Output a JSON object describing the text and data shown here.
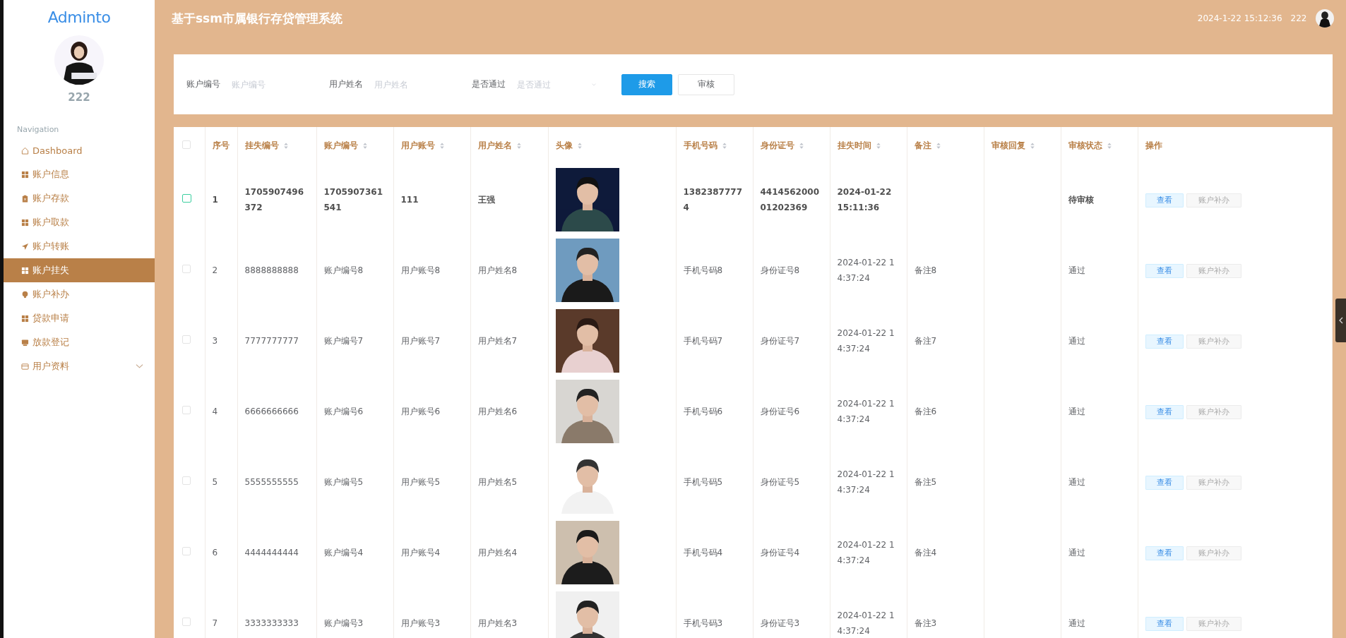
{
  "header": {
    "title": "基于ssm市属银行存贷管理系统",
    "datetime": "2024-1-22 15:12:36",
    "username": "222"
  },
  "sidebar": {
    "logo": "Adminto",
    "username": "222",
    "section": "Navigation",
    "items": [
      {
        "label": "Dashboard",
        "kind": "home",
        "selected": false
      },
      {
        "label": "账户信息",
        "kind": "grid",
        "selected": false
      },
      {
        "label": "账户存款",
        "kind": "clipboard",
        "selected": false
      },
      {
        "label": "账户取款",
        "kind": "grid",
        "selected": false
      },
      {
        "label": "账户转账",
        "kind": "plane",
        "selected": false
      },
      {
        "label": "账户挂失",
        "kind": "grid",
        "selected": true
      },
      {
        "label": "账户补办",
        "kind": "bulb",
        "selected": false
      },
      {
        "label": "贷款申请",
        "kind": "grid",
        "selected": false
      },
      {
        "label": "放款登记",
        "kind": "box",
        "selected": false
      },
      {
        "label": "用户资料",
        "kind": "card",
        "selected": false,
        "expanded": false
      }
    ]
  },
  "search": {
    "fields": [
      {
        "label": "账户编号",
        "placeholder": "账户编号",
        "kind": "input"
      },
      {
        "label": "用户姓名",
        "placeholder": "用户姓名",
        "kind": "input"
      },
      {
        "label": "是否通过",
        "placeholder": "是否通过",
        "kind": "select"
      }
    ],
    "buttons": [
      {
        "label": "搜索",
        "kind": "primary"
      },
      {
        "label": "审核",
        "kind": "plain"
      }
    ]
  },
  "table": {
    "all_checked": false,
    "columns": [
      {
        "label": "序号",
        "sortable": false
      },
      {
        "label": "挂失编号",
        "sortable": true
      },
      {
        "label": "账户编号",
        "sortable": true
      },
      {
        "label": "用户账号",
        "sortable": true
      },
      {
        "label": "用户姓名",
        "sortable": true
      },
      {
        "label": "头像",
        "sortable": true
      },
      {
        "label": "手机号码",
        "sortable": true
      },
      {
        "label": "身份证号",
        "sortable": true
      },
      {
        "label": "挂失时间",
        "sortable": true
      },
      {
        "label": "备注",
        "sortable": true
      },
      {
        "label": "审核回复",
        "sortable": true
      },
      {
        "label": "审核状态",
        "sortable": true
      },
      {
        "label": "操作",
        "sortable": false
      }
    ],
    "rows": [
      {
        "hovered": true,
        "index": "1",
        "loss_no": "1705907496372",
        "account_no": "1705907361541",
        "user_account": "111",
        "user_name": "王强",
        "phone": "13823877774",
        "id_no": "441456200001202369",
        "time": "2024-01-22 15:11:36",
        "status": "待审核",
        "actions": [
          "查看",
          "账户补办"
        ]
      },
      {
        "hovered": false,
        "index": "2",
        "loss_no": "8888888888",
        "account_no": "账户编号8",
        "user_account": "用户账号8",
        "user_name": "用户姓名8",
        "phone": "手机号码8",
        "id_no": "身份证号8",
        "time": "2024-01-22 14:37:24",
        "note": "备注8",
        "status": "通过",
        "actions": [
          "查看",
          "账户补办"
        ]
      },
      {
        "hovered": false,
        "index": "3",
        "loss_no": "7777777777",
        "account_no": "账户编号7",
        "user_account": "用户账号7",
        "user_name": "用户姓名7",
        "phone": "手机号码7",
        "id_no": "身份证号7",
        "time": "2024-01-22 14:37:24",
        "note": "备注7",
        "status": "通过",
        "actions": [
          "查看",
          "账户补办"
        ]
      },
      {
        "hovered": false,
        "index": "4",
        "loss_no": "6666666666",
        "account_no": "账户编号6",
        "user_account": "用户账号6",
        "user_name": "用户姓名6",
        "phone": "手机号码6",
        "id_no": "身份证号6",
        "time": "2024-01-22 14:37:24",
        "note": "备注6",
        "status": "通过",
        "actions": [
          "查看",
          "账户补办"
        ]
      },
      {
        "hovered": false,
        "index": "5",
        "loss_no": "5555555555",
        "account_no": "账户编号5",
        "user_account": "用户账号5",
        "user_name": "用户姓名5",
        "phone": "手机号码5",
        "id_no": "身份证号5",
        "time": "2024-01-22 14:37:24",
        "note": "备注5",
        "status": "通过",
        "actions": [
          "查看",
          "账户补办"
        ]
      },
      {
        "hovered": false,
        "index": "6",
        "loss_no": "4444444444",
        "account_no": "账户编号4",
        "user_account": "用户账号4",
        "user_name": "用户姓名4",
        "phone": "手机号码4",
        "id_no": "身份证号4",
        "time": "2024-01-22 14:37:24",
        "note": "备注4",
        "status": "通过",
        "actions": [
          "查看",
          "账户补办"
        ]
      },
      {
        "hovered": false,
        "index": "7",
        "loss_no": "3333333333",
        "account_no": "账户编号3",
        "user_account": "用户账号3",
        "user_name": "用户姓名3",
        "phone": "手机号码3",
        "id_no": "身份证号3",
        "time": "2024-01-22 14:37:24",
        "note": "备注3",
        "status": "通过",
        "actions": [
          "查看",
          "账户补办"
        ]
      }
    ]
  }
}
